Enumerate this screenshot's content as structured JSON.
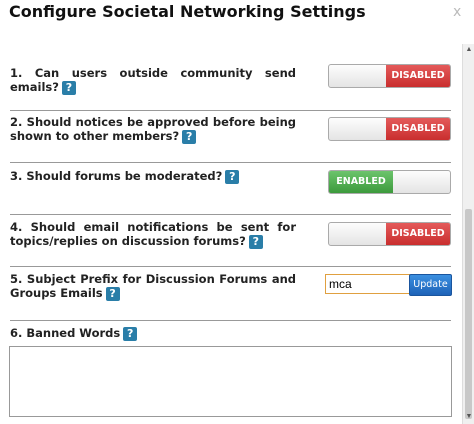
{
  "dialog": {
    "title": "Configure Societal Networking Settings",
    "close": "x"
  },
  "settings": [
    {
      "question": "1. Can users outside community send emails?",
      "state": "DISABLED"
    },
    {
      "question": "2. Should notices be approved before being shown to other members?",
      "state": "DISABLED"
    },
    {
      "question": "3. Should forums be moderated?",
      "state": "ENABLED"
    },
    {
      "question": "4. Should email notifications be sent for topics/replies on discussion forums?",
      "state": "DISABLED"
    }
  ],
  "subject_prefix": {
    "question": "5. Subject Prefix for Discussion Forums and Groups Emails",
    "value": "mca",
    "button": "Update"
  },
  "banned_words": {
    "question": "6. Banned Words",
    "value": ""
  },
  "help_glyph": "?",
  "colors": {
    "disabled": "#d23a3a",
    "enabled": "#4aab4a",
    "help": "#2a7ea8",
    "button": "#2a72c8"
  }
}
